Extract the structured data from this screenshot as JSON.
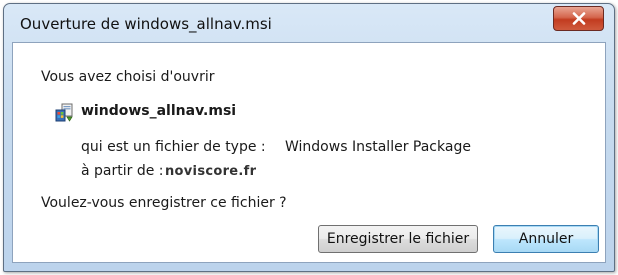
{
  "window": {
    "title": "Ouverture de windows_allnav.msi"
  },
  "dialog": {
    "prompt": "Vous avez choisi d'ouvrir",
    "file_name": "windows_allnav.msi",
    "file_icon": "msi-installer-icon",
    "type_label": "qui est un fichier de type :",
    "type_value": "Windows Installer Package",
    "from_label": "à partir de :",
    "from_value": "noviscore.fr",
    "question": "Voulez-vous enregistrer ce fichier ?"
  },
  "buttons": {
    "save_label": "Enregistrer le fichier",
    "cancel_label": "Annuler"
  },
  "colors": {
    "close_button": "#c23c20",
    "frame": "#c7dbef",
    "default_button_border": "#3c7fb1"
  }
}
